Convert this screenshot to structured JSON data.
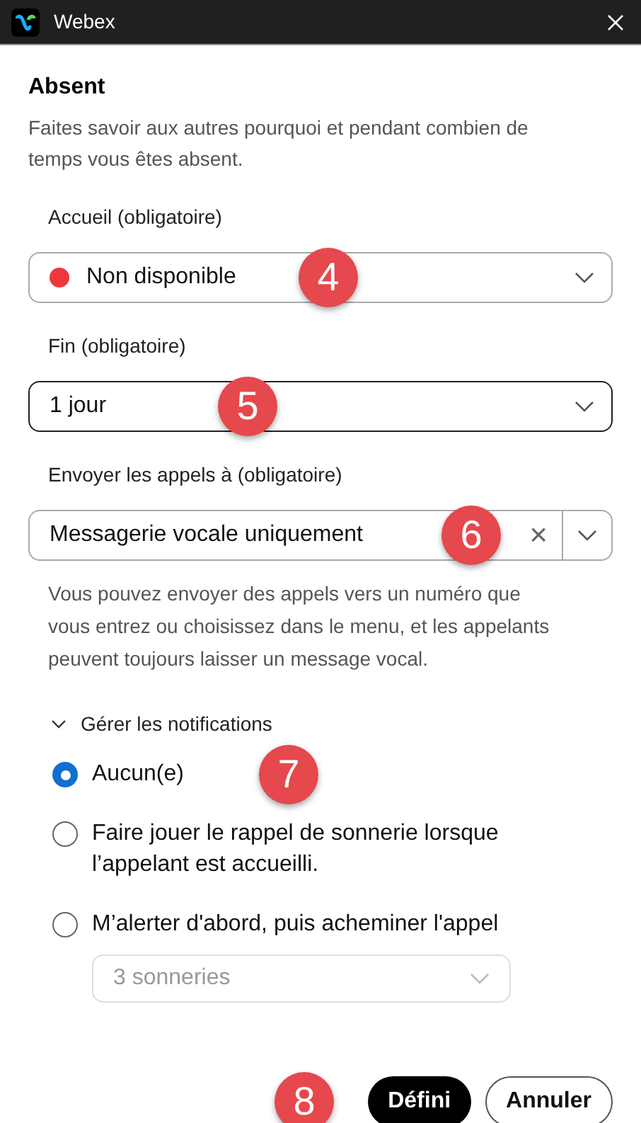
{
  "window": {
    "title": "Webex"
  },
  "heading": "Absent",
  "description": "Faites savoir aux autres pourquoi et pendant combien de temps vous êtes absent.",
  "fields": [
    {
      "kind": "status",
      "label": "Accueil (obligatoire)",
      "value": "Non disponible",
      "color": "#f0363d",
      "focused": false,
      "callout": "4"
    },
    {
      "kind": "select",
      "label": "Fin (obligatoire)",
      "value": "1 jour",
      "focused": true,
      "callout": "5"
    },
    {
      "kind": "clearable",
      "label": "Envoyer les appels à (obligatoire)",
      "value": "Messagerie vocale uniquement",
      "clear": "×",
      "focused": false,
      "callout": "6"
    }
  ],
  "helper": "Vous pouvez envoyer des appels vers un numéro que vous entrez ou choisissez dans le menu, et les appelants peuvent toujours laisser un message vocal.",
  "notifications": {
    "label": "Gérer les notifications",
    "expanded": true,
    "options": [
      {
        "label": "Aucun(e)",
        "selected": true,
        "callout": "7"
      },
      {
        "label": "Faire jouer le rappel de sonnerie lorsque l’appelant est accueilli.",
        "selected": false
      },
      {
        "label": "M’alerter d'abord, puis acheminer l'appel",
        "selected": false,
        "sub_select": {
          "value": "3 sonneries",
          "disabled": true
        }
      }
    ]
  },
  "buttons": [
    {
      "label": "Défini",
      "primary": true
    },
    {
      "label": "Annuler",
      "primary": false
    }
  ],
  "footer_callout": "8"
}
